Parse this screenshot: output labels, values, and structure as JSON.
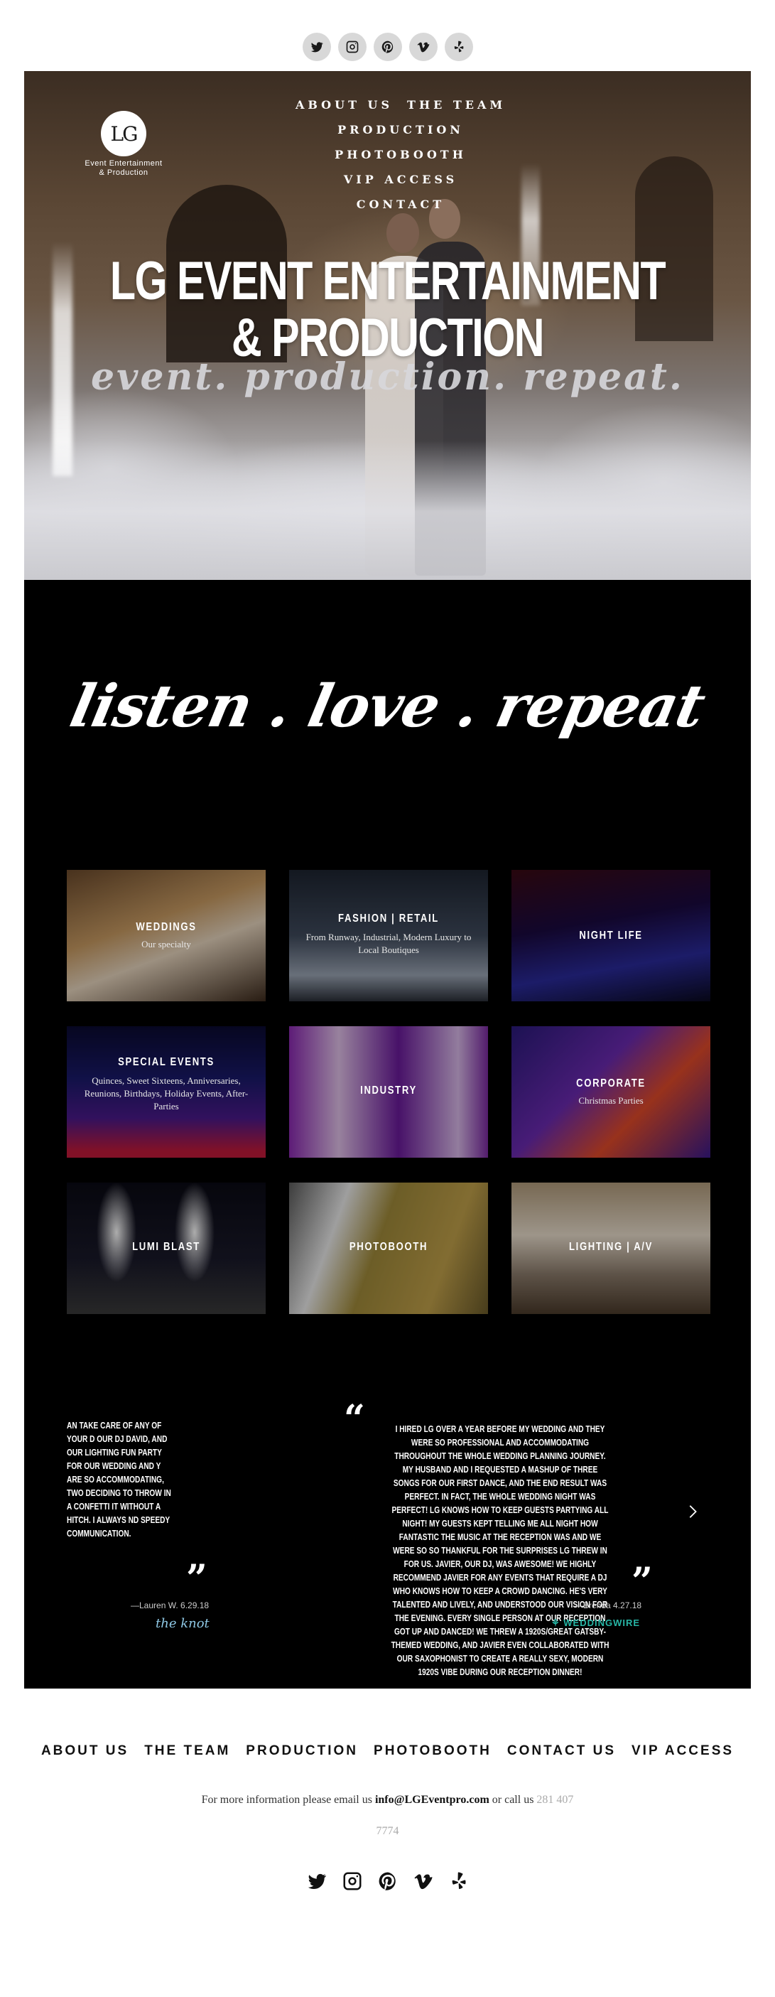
{
  "social": {
    "items": [
      {
        "name": "twitter"
      },
      {
        "name": "instagram"
      },
      {
        "name": "pinterest"
      },
      {
        "name": "vimeo"
      },
      {
        "name": "yelp"
      }
    ]
  },
  "logo": {
    "mark": "LG",
    "line1": "Event Entertainment",
    "line2": "& Production"
  },
  "hero_nav": {
    "about": "About Us",
    "team": "The Team",
    "production": "Production",
    "photobooth": "Photobooth",
    "vip": "VIP Access",
    "contact": "Contact"
  },
  "hero": {
    "title_line1": "LG EVENT ENTERTAINMENT",
    "title_line2": "& PRODUCTION",
    "subtitle": "event. production. repeat."
  },
  "tagline": "listen . love . repeat",
  "services": [
    {
      "title": "Weddings",
      "desc": "Our specialty"
    },
    {
      "title": "Fashion | Retail",
      "desc": "From Runway, Industrial, Modern Luxury to Local Boutiques"
    },
    {
      "title": "Night Life",
      "desc": ""
    },
    {
      "title": "Special Events",
      "desc": "Quinces, Sweet Sixteens, Anniversaries, Reunions, Birthdays, Holiday Events, After-Parties"
    },
    {
      "title": "Industry",
      "desc": ""
    },
    {
      "title": "Corporate",
      "desc": "Christmas Parties"
    },
    {
      "title": "Lumi Blast",
      "desc": ""
    },
    {
      "title": "Photobooth",
      "desc": ""
    },
    {
      "title": "Lighting | A/V",
      "desc": ""
    }
  ],
  "testimonials": {
    "left": {
      "text": "an take care of any of your d our DJ David, and our lighting fun party for our wedding and y are so accommodating, two deciding to throw in a confetti it without a hitch. I always nd speedy communication.",
      "author": "—Lauren W. 6.29.18",
      "badge": "the knot"
    },
    "main": {
      "text": "I hired LG over a year before my wedding and they were so professional and accommodating throughout the whole wedding planning journey. My husband and I requested a mashup of three songs for our first dance, and the end result was perfect. In fact, the whole wedding night was perfect! LG knows how to keep guests partying all night! My guests kept telling me all night how fantastic the music at the reception was and we were so so thankful for the surprises LG threw in for us. Javier, our DJ, was awesome! We highly recommend Javier for any events that require a DJ who knows how to keep a crowd dancing. He's very talented and lively, and understood our vision for the evening. Every single person at our reception got up and danced! We threw a 1920s/Great Gatsby-themed wedding, and Javier even collaborated with our saxophonist to create a really sexy, modern 1920s vibe during our reception dinner!",
      "author": "—Brenda 4.27.18",
      "badge": "WEDDINGWIRE"
    }
  },
  "footer": {
    "nav": [
      "About Us",
      "The Team",
      "Production",
      "Photobooth",
      "Contact Us",
      "VIP Access"
    ],
    "info_prefix": "For more information please email us",
    "email": "info@LGEventpro.com",
    "info_mid": "or call us",
    "phone_part1": "281 407",
    "phone_part2": "7774"
  }
}
